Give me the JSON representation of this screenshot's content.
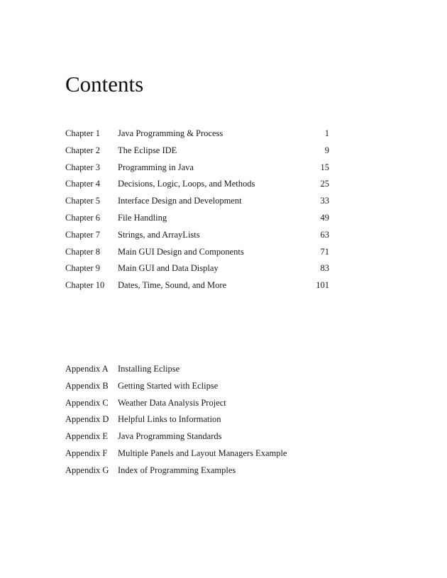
{
  "title": "Contents",
  "chapters": [
    {
      "label": "Chapter 1",
      "title": "Java Programming & Process",
      "page": "1"
    },
    {
      "label": "Chapter 2",
      "title": "The Eclipse IDE",
      "page": "9"
    },
    {
      "label": "Chapter 3",
      "title": "Programming in Java",
      "page": "15"
    },
    {
      "label": "Chapter 4",
      "title": "Decisions, Logic, Loops, and Methods",
      "page": "25"
    },
    {
      "label": "Chapter 5",
      "title": "Interface Design and Development",
      "page": "33"
    },
    {
      "label": "Chapter 6",
      "title": "File Handling",
      "page": "49"
    },
    {
      "label": "Chapter 7",
      "title": "Strings, and ArrayLists",
      "page": "63"
    },
    {
      "label": "Chapter 8",
      "title": "Main GUI Design and Components",
      "page": "71"
    },
    {
      "label": "Chapter 9",
      "title": "Main GUI and Data Display",
      "page": "83"
    },
    {
      "label": "Chapter 10",
      "title": "Dates, Time, Sound, and More",
      "page": "101"
    }
  ],
  "appendices": [
    {
      "label": "Appendix A",
      "title": "Installing Eclipse"
    },
    {
      "label": "Appendix B",
      "title": "Getting Started with Eclipse"
    },
    {
      "label": "Appendix C",
      "title": "Weather Data Analysis Project"
    },
    {
      "label": "Appendix D",
      "title": "Helpful Links to Information"
    },
    {
      "label": "Appendix E",
      "title": "Java Programming Standards"
    },
    {
      "label": "Appendix F",
      "title": "Multiple Panels and Layout Managers Example"
    },
    {
      "label": "Appendix G",
      "title": "Index of Programming Examples"
    }
  ]
}
